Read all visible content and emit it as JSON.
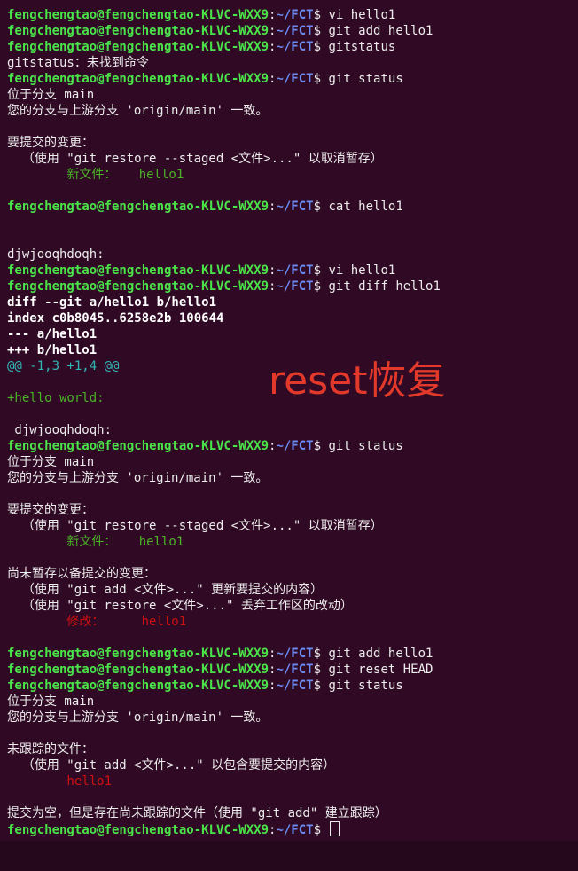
{
  "prompt": {
    "user_host": "fengchengtao@fengchengtao-KLVC-WXX9",
    "colon": ":",
    "path": "~/FCT",
    "symbol": "$ "
  },
  "lines": [
    {
      "type": "prompt",
      "cmd": "vi hello1"
    },
    {
      "type": "prompt",
      "cmd": "git add hello1"
    },
    {
      "type": "prompt",
      "cmd": "gitstatus"
    },
    {
      "type": "text",
      "text": "gitstatus：未找到命令"
    },
    {
      "type": "prompt",
      "cmd": "git status"
    },
    {
      "type": "text",
      "text": "位于分支 main"
    },
    {
      "type": "text",
      "text": "您的分支与上游分支 'origin/main' 一致。"
    },
    {
      "type": "blank"
    },
    {
      "type": "text",
      "text": "要提交的变更："
    },
    {
      "type": "text",
      "text": "  （使用 \"git restore --staged <文件>...\" 以取消暂存）"
    },
    {
      "type": "green",
      "text": "        新文件：   hello1"
    },
    {
      "type": "blank"
    },
    {
      "type": "prompt",
      "cmd": "cat hello1"
    },
    {
      "type": "blank"
    },
    {
      "type": "blank"
    },
    {
      "type": "text",
      "text": "djwjooqhdoqh:"
    },
    {
      "type": "prompt",
      "cmd": "vi hello1"
    },
    {
      "type": "prompt",
      "cmd": "git diff hello1"
    },
    {
      "type": "bold",
      "text": "diff --git a/hello1 b/hello1"
    },
    {
      "type": "bold",
      "text": "index c0b8045..6258e2b 100644"
    },
    {
      "type": "bold",
      "text": "--- a/hello1"
    },
    {
      "type": "bold",
      "text": "+++ b/hello1"
    },
    {
      "type": "cyan",
      "text": "@@ -1,3 +1,4 @@"
    },
    {
      "type": "blank"
    },
    {
      "type": "green",
      "text": "+hello world:"
    },
    {
      "type": "blank"
    },
    {
      "type": "text",
      "text": " djwjooqhdoqh:"
    },
    {
      "type": "prompt",
      "cmd": "git status"
    },
    {
      "type": "text",
      "text": "位于分支 main"
    },
    {
      "type": "text",
      "text": "您的分支与上游分支 'origin/main' 一致。"
    },
    {
      "type": "blank"
    },
    {
      "type": "text",
      "text": "要提交的变更："
    },
    {
      "type": "text",
      "text": "  （使用 \"git restore --staged <文件>...\" 以取消暂存）"
    },
    {
      "type": "green",
      "text": "        新文件：   hello1"
    },
    {
      "type": "blank"
    },
    {
      "type": "text",
      "text": "尚未暂存以备提交的变更："
    },
    {
      "type": "text",
      "text": "  （使用 \"git add <文件>...\" 更新要提交的内容）"
    },
    {
      "type": "text",
      "text": "  （使用 \"git restore <文件>...\" 丢弃工作区的改动）"
    },
    {
      "type": "red",
      "text": "        修改：     hello1"
    },
    {
      "type": "blank"
    },
    {
      "type": "prompt",
      "cmd": "git add hello1"
    },
    {
      "type": "prompt",
      "cmd": "git reset HEAD"
    },
    {
      "type": "prompt",
      "cmd": "git status"
    },
    {
      "type": "text",
      "text": "位于分支 main"
    },
    {
      "type": "text",
      "text": "您的分支与上游分支 'origin/main' 一致。"
    },
    {
      "type": "blank"
    },
    {
      "type": "text",
      "text": "未跟踪的文件："
    },
    {
      "type": "text",
      "text": "  （使用 \"git add <文件>...\" 以包含要提交的内容）"
    },
    {
      "type": "red",
      "text": "        hello1"
    },
    {
      "type": "blank"
    },
    {
      "type": "text",
      "text": "提交为空，但是存在尚未跟踪的文件（使用 \"git add\" 建立跟踪）"
    },
    {
      "type": "prompt",
      "cmd": "",
      "cursor": true
    }
  ],
  "annotation": "reset恢复",
  "colors": {
    "background": "#300a24",
    "prompt_user": "#4ae34a",
    "prompt_path": "#6c8cf5",
    "green": "#4ab326",
    "red": "#cc1010",
    "cyan": "#31b6b6",
    "annotation": "#e2392b"
  }
}
